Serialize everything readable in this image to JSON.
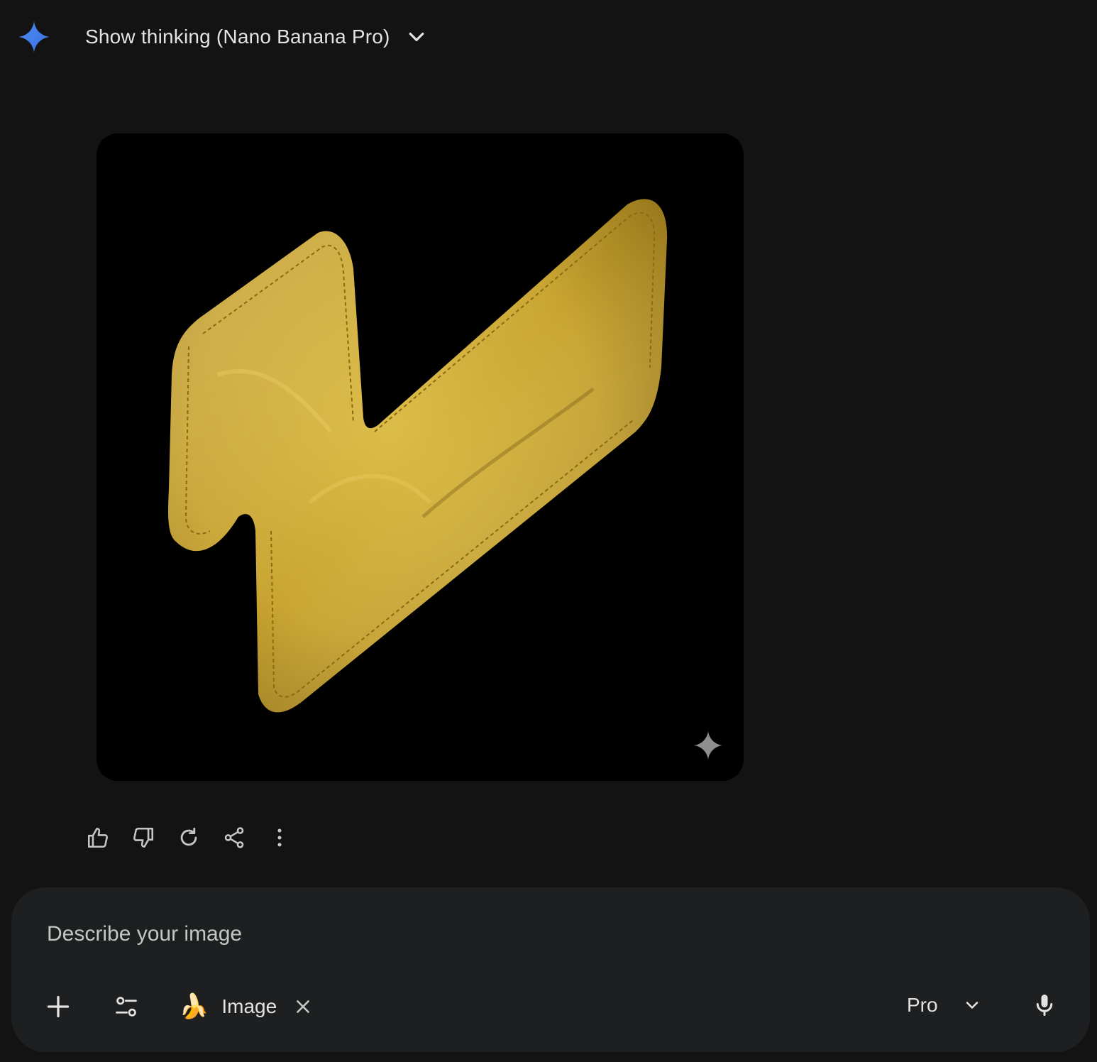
{
  "header": {
    "icon": "gemini-sparkle-icon",
    "thinking_label": "Show thinking (Nano Banana Pro)",
    "chevron_icon": "chevron-down-icon"
  },
  "response": {
    "image": {
      "description_icon": "generated-image",
      "watermark_icon": "sparkle-watermark-icon"
    },
    "actions": [
      {
        "name": "thumbs-up-icon"
      },
      {
        "name": "thumbs-down-icon"
      },
      {
        "name": "regenerate-icon"
      },
      {
        "name": "share-icon"
      },
      {
        "name": "more-options-icon"
      }
    ]
  },
  "composer": {
    "placeholder": "Describe your image",
    "add_icon": "plus-icon",
    "tools_icon": "tools-sliders-icon",
    "chip": {
      "emoji": "🍌",
      "label": "Image",
      "close_icon": "close-icon"
    },
    "model": {
      "label": "Pro",
      "icon": "chevron-down-icon"
    },
    "mic_icon": "microphone-icon"
  },
  "colors": {
    "background": "#131314",
    "composer": "#1e1f20",
    "accent_blue": "#4285f4",
    "text": "#e3e3e3",
    "pillow": "#c9a431"
  }
}
